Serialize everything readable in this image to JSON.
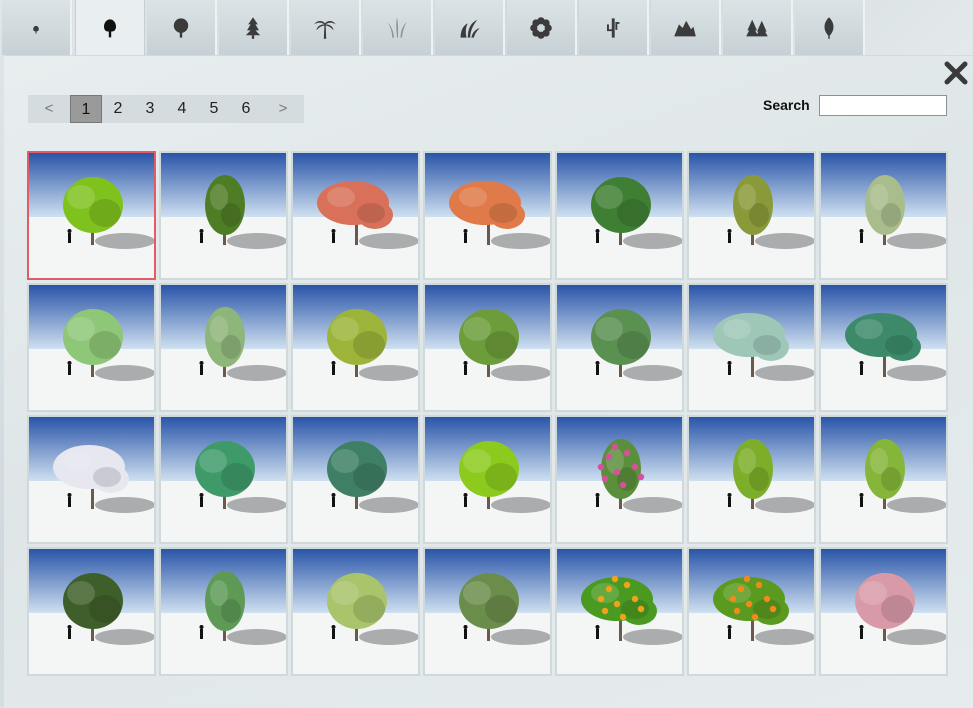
{
  "tabs": [
    {
      "icon": "small-plant-icon",
      "active": false
    },
    {
      "icon": "deciduous-tree-icon",
      "active": true
    },
    {
      "icon": "broadleaf-tree-icon",
      "active": false
    },
    {
      "icon": "conifer-tree-icon",
      "active": false
    },
    {
      "icon": "palm-tree-icon",
      "active": false
    },
    {
      "icon": "grass-icon",
      "active": false
    },
    {
      "icon": "shrub-icon",
      "active": false
    },
    {
      "icon": "flower-icon",
      "active": false
    },
    {
      "icon": "cactus-icon",
      "active": false
    },
    {
      "icon": "rocks-icon",
      "active": false
    },
    {
      "icon": "forest-icon",
      "active": false
    },
    {
      "icon": "leaf-icon",
      "active": false
    }
  ],
  "pagination": {
    "prev": "<",
    "next": ">",
    "pages": [
      "1",
      "2",
      "3",
      "4",
      "5",
      "6"
    ],
    "current": "1"
  },
  "search": {
    "label": "Search",
    "value": "",
    "placeholder": ""
  },
  "close_icon": "close-icon",
  "colors": {
    "selected_border": "#e25c68",
    "sky_top": "#2a55a8",
    "ground": "#f4f6f6"
  },
  "gallery": [
    {
      "foliage": "#7fc21e",
      "shape": "round",
      "selected": true
    },
    {
      "foliage": "#4f7d26",
      "shape": "narrow"
    },
    {
      "foliage": "#d9715a",
      "shape": "wide"
    },
    {
      "foliage": "#e07a48",
      "shape": "wide"
    },
    {
      "foliage": "#3f7f34",
      "shape": "round"
    },
    {
      "foliage": "#8a9a3a",
      "shape": "narrow"
    },
    {
      "foliage": "#a9bd8c",
      "shape": "narrow"
    },
    {
      "foliage": "#8ec777",
      "shape": "round"
    },
    {
      "foliage": "#8fb67a",
      "shape": "narrow"
    },
    {
      "foliage": "#9db43a",
      "shape": "round"
    },
    {
      "foliage": "#6c9d3a",
      "shape": "round"
    },
    {
      "foliage": "#5a9050",
      "shape": "round"
    },
    {
      "foliage": "#9ec7b8",
      "shape": "wide"
    },
    {
      "foliage": "#3d8a6a",
      "shape": "wide"
    },
    {
      "foliage": "#e6e7ef",
      "shape": "wide"
    },
    {
      "foliage": "#3f9a6a",
      "shape": "round"
    },
    {
      "foliage": "#3f7f66",
      "shape": "round"
    },
    {
      "foliage": "#8ccb1e",
      "shape": "round"
    },
    {
      "foliage": "#5c8f3c",
      "shape": "narrow",
      "blossom": "#d94fa0"
    },
    {
      "foliage": "#7cae2a",
      "shape": "narrow"
    },
    {
      "foliage": "#85b63a",
      "shape": "narrow"
    },
    {
      "foliage": "#3f5f2a",
      "shape": "round"
    },
    {
      "foliage": "#5e9a56",
      "shape": "narrow"
    },
    {
      "foliage": "#a9c46a",
      "shape": "round"
    },
    {
      "foliage": "#6b8d4c",
      "shape": "round"
    },
    {
      "foliage": "#4a9a22",
      "shape": "wide",
      "blossom": "#f2a21a"
    },
    {
      "foliage": "#5a9a1e",
      "shape": "wide",
      "blossom": "#f08a1a"
    },
    {
      "foliage": "#d99aa8",
      "shape": "round"
    }
  ]
}
